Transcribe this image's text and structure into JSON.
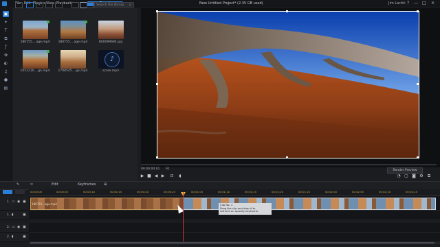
{
  "menu": [
    "File",
    "Edit",
    "Plugins",
    "View",
    "Playback"
  ],
  "export_label": "Export",
  "project_title": "New Untitled Project* (2.35 GB used)",
  "user": "Jim Lacitti",
  "window_controls": [
    "?",
    "—",
    "□",
    "×"
  ],
  "search_placeholder": "Search the library",
  "library": [
    {
      "caption": "180755....age.mp4"
    },
    {
      "caption": "180755....age.mp4"
    },
    {
      "caption": "800099692.jpg"
    },
    {
      "caption": "1053216....ge.mp4"
    },
    {
      "caption": "1708545....ge.mp4"
    },
    {
      "caption": "score.mp3"
    }
  ],
  "player": {
    "timecode": "00:00:00:01",
    "fit": "Fit",
    "render_preview": "Render Preview"
  },
  "timeline_toolbar": {
    "edit": "Edit",
    "keyframes": "Keyframes"
  },
  "ruler_ticks": [
    "00;00;00",
    "00;00;05",
    "00;00;10",
    "00;00;15",
    "00;00;20",
    "00;00;25",
    "00;01;05",
    "00;01;10",
    "00;01;15",
    "00;01;20",
    "00;01;25",
    "00;02;00",
    "00;02;05",
    "00;02;10",
    "00;02;15",
    "00;02;20",
    "00;02;25",
    "01;00;02",
    "01;00;07"
  ],
  "tracks": [
    "1.",
    "1.",
    "2.",
    "2."
  ],
  "clip_a_label": "180755...age.mp4",
  "tooltip": {
    "title": "Clip No. 1",
    "line1": "Drag the clip and drop it to",
    "line2": "retrieve an opacity keyframe."
  },
  "colors": {
    "accent": "#2b7fd6",
    "playhead": "#e03030",
    "ruler_text": "#c8a84a"
  }
}
